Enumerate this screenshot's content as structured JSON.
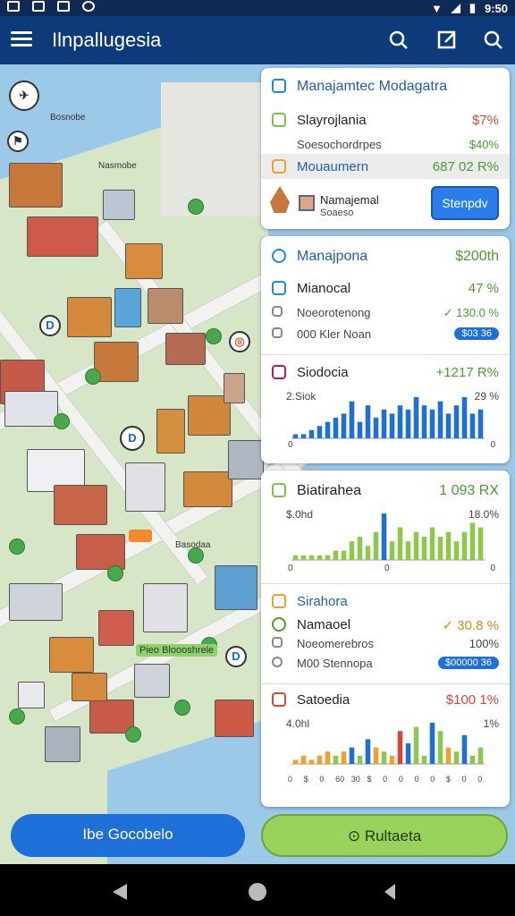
{
  "status_bar": {
    "time": "9:50"
  },
  "app_bar": {
    "title": "Ilnpallugesia"
  },
  "map": {
    "labels": [
      "Bosnobe",
      "Nasmobe",
      "Basodaa",
      "Pieo Bloooshrele"
    ],
    "pins": [
      "D",
      "D",
      "D"
    ]
  },
  "panel1": {
    "header": "Manajamtec Modagatra",
    "row1": {
      "label": "Slayrojlania",
      "value": "$7%"
    },
    "row2": {
      "label": "Soesochordrpes",
      "value": "$40%"
    },
    "row3": {
      "label": "Mouaumern",
      "value": "687 02 R%"
    },
    "item": {
      "label": "Namajemal",
      "sub": "Soaeso"
    },
    "button": "Stenpdv"
  },
  "panel2": {
    "header": {
      "label": "Manajpona",
      "value": "$200th"
    },
    "row1": {
      "label": "Mianocal",
      "value": "47 %"
    },
    "row2": {
      "label": "Noeorotenong",
      "value": "✓ 130.0 %"
    },
    "row3": {
      "label": "000 Kler Noan",
      "pill": "$03 36"
    },
    "chart_title": {
      "label": "Siodocia",
      "value": "+1217 R%"
    },
    "chart": {
      "left_label": "2.Siok",
      "right_label": "29 %",
      "zero_left": "0",
      "zero_right": "0"
    }
  },
  "panel3": {
    "chart_title": {
      "label": "Biatirahea",
      "value": "1 093 RX"
    },
    "chart": {
      "left_label": "$.0hd",
      "right_label": "18.0%",
      "zero_left": "0",
      "zero_mid": "0",
      "zero_right": "0"
    },
    "section": {
      "label": "Sirahora"
    },
    "row1": {
      "label": "Namaoel",
      "value": "✓ 30.8 %"
    },
    "row2": {
      "label": "Noeomerebros",
      "value": "100%"
    },
    "row3": {
      "label": "M00 Stennopa",
      "pill": "$00000 36"
    },
    "chart2_title": {
      "label": "Satoedia",
      "value": "$100 1%"
    },
    "chart2": {
      "left_label": "4.0hl",
      "right_label": "1%",
      "x_labels": [
        "0",
        "$",
        "0",
        "60",
        "30",
        "$",
        "0",
        "0",
        "0",
        "0",
        "$",
        "0",
        "0"
      ]
    }
  },
  "bottom": {
    "left_button": "Ibe Gocobelo",
    "right_button": "Rultaeta"
  },
  "colors": {
    "appbar": "#0d3b79",
    "accent_blue": "#1e88e5",
    "accent_green": "#7cc24a",
    "red": "#d9453c",
    "orange": "#f0a12b"
  },
  "chart_data": [
    {
      "type": "bar",
      "values": [
        1,
        1,
        2,
        3,
        4,
        5,
        6,
        9,
        4,
        8,
        5,
        7,
        6,
        8,
        7,
        10,
        8,
        7,
        9,
        6,
        8,
        10,
        6,
        7
      ],
      "color": "#1e6fd8"
    },
    {
      "type": "bar",
      "values": [
        1,
        1,
        1,
        1,
        1,
        2,
        2,
        4,
        5,
        3,
        6,
        10,
        4,
        7,
        4,
        6,
        5,
        7,
        5,
        6,
        4,
        6,
        8,
        7
      ],
      "colors": [
        "green",
        "green",
        "green",
        "green",
        "green",
        "green",
        "green",
        "green",
        "green",
        "green",
        "green",
        "blue",
        "green",
        "green",
        "green",
        "green",
        "green",
        "green",
        "green",
        "green",
        "green",
        "green",
        "green",
        "green"
      ]
    },
    {
      "type": "bar",
      "values": [
        1,
        2,
        1,
        2,
        3,
        2,
        3,
        4,
        2,
        6,
        4,
        3,
        2,
        8,
        5,
        9,
        2,
        10,
        8,
        4,
        3,
        7,
        2,
        4
      ],
      "colors": [
        "orange",
        "orange",
        "orange",
        "orange",
        "orange",
        "green",
        "orange",
        "blue",
        "green",
        "blue",
        "orange",
        "green",
        "orange",
        "red",
        "blue",
        "green",
        "green",
        "blue",
        "green",
        "orange",
        "green",
        "blue",
        "green",
        "green"
      ]
    }
  ]
}
